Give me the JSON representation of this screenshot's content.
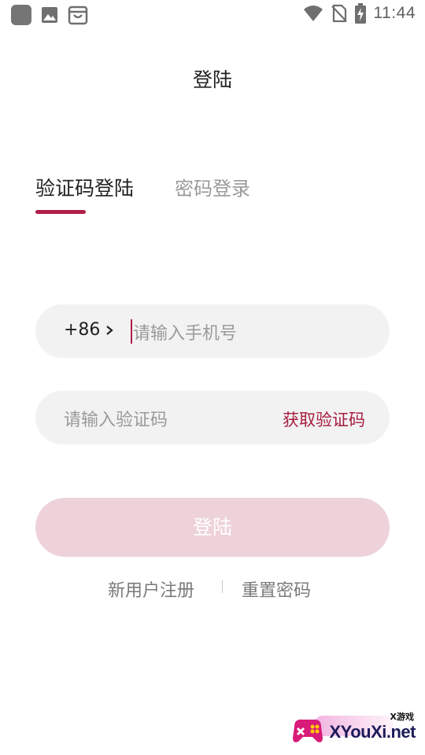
{
  "status_bar": {
    "time": "11:44",
    "icons": [
      "app-icon",
      "image-icon",
      "shopping-bag-icon",
      "wifi-icon",
      "no-sim-icon",
      "battery-charging-icon"
    ]
  },
  "page": {
    "title": "登陆"
  },
  "tabs": [
    {
      "label": "验证码登陆",
      "active": true
    },
    {
      "label": "密码登录",
      "active": false
    }
  ],
  "phone_field": {
    "country_code": "+86",
    "placeholder": "请输入手机号",
    "value": ""
  },
  "code_field": {
    "placeholder": "请输入验证码",
    "value": "",
    "action_label": "获取验证码"
  },
  "login_button": {
    "label": "登陆"
  },
  "links": {
    "register": "新用户注册",
    "reset_password": "重置密码"
  },
  "watermark": {
    "text": "XYouXi.net",
    "subtext": "X游戏"
  },
  "colors": {
    "accent": "#b01e48",
    "button_disabled": "#eed2d9",
    "field_bg": "#f2f2f2"
  }
}
